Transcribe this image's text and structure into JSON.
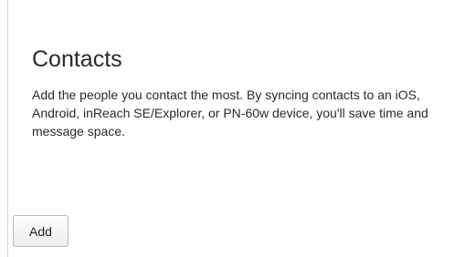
{
  "contacts": {
    "title": "Contacts",
    "description": "Add the people you contact the most. By syncing contacts to an iOS, Android, inReach SE/Explorer, or PN-60w device, you'll save time and message space.",
    "add_label": "Add"
  }
}
